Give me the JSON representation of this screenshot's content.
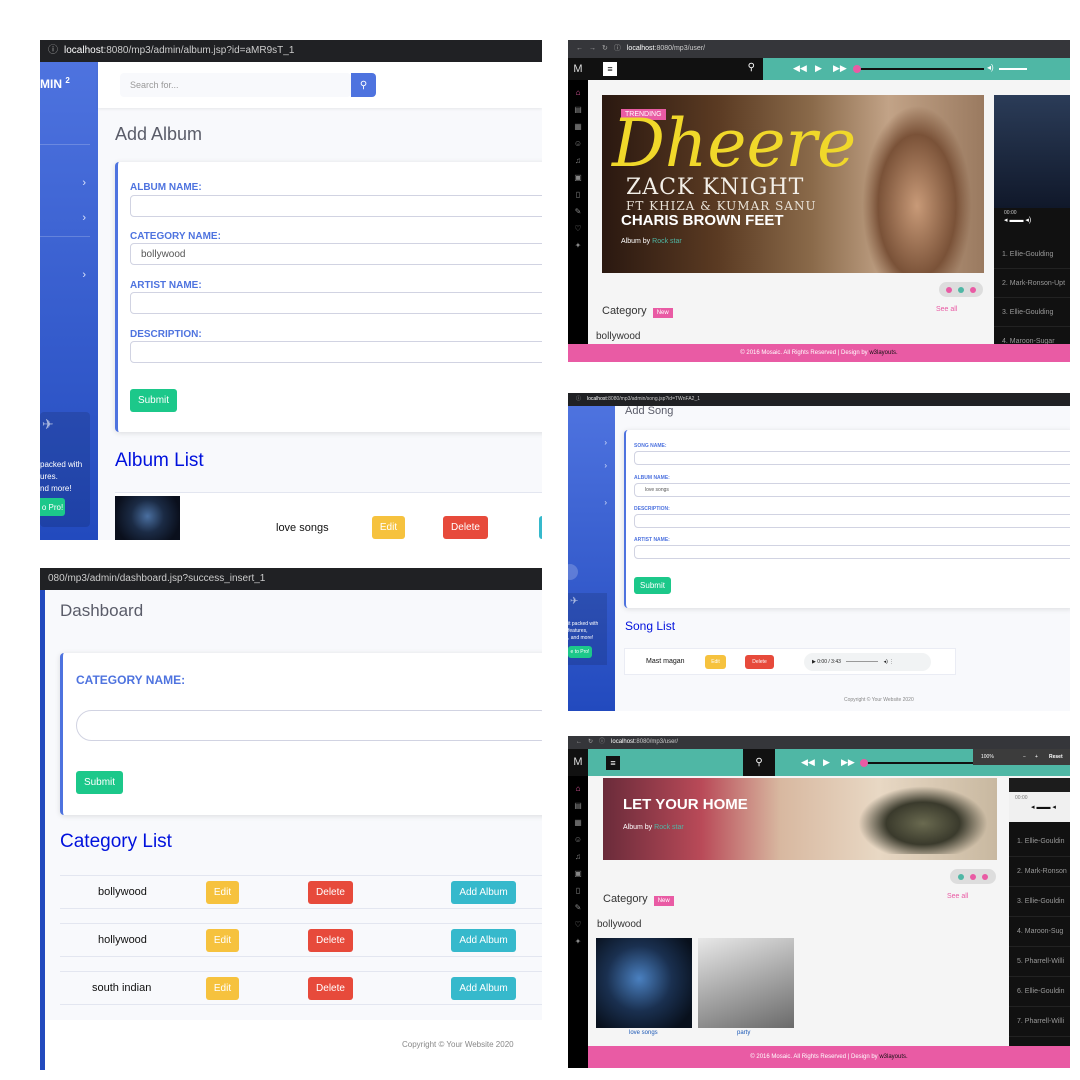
{
  "album_page": {
    "url_host": "localhost",
    "url_rest": ":8080/mp3/admin/album.jsp?id=aMR9sT_1",
    "brand": "MIN",
    "brand_sup": "2",
    "search_placeholder": "Search for...",
    "heading": "Add Album",
    "labels": [
      "ALBUM NAME:",
      "CATEGORY NAME:",
      "ARTIST NAME:",
      "DESCRIPTION:"
    ],
    "values": [
      "",
      "bollywood",
      "",
      ""
    ],
    "submit": "Submit",
    "list_title": "Album List",
    "promo_lines": [
      "packed with",
      "ures.",
      "nd more!"
    ],
    "promo_button": "o Pro!",
    "row": {
      "name": "love songs",
      "edit": "Edit",
      "delete": "Delete"
    }
  },
  "user_page_1": {
    "url_host": "localhost",
    "url_rest": ":8080/mp3/user/",
    "logo": "M",
    "trending": "TRENDING",
    "banner_script": "Dheere",
    "banner_artist": "ZACK KNIGHT",
    "banner_ft": "FT KHIZA & KUMAR SANU",
    "banner_sub": "CHARIS BROWN FEET",
    "album_by": "Album by",
    "album_by_link": "Rock star",
    "time": "00:00",
    "category": "Category",
    "new_badge": "New",
    "see_all": "See all",
    "cat_item": "bollywood",
    "songs": [
      "1. Ellie-Goulding",
      "2. Mark-Ronson-Upt",
      "3. Ellie-Goulding",
      "4. Maroon-Sugar"
    ],
    "footer_text": "© 2016 Mosaic. All Rights Reserved | Design by ",
    "footer_link": "w3layouts."
  },
  "song_page": {
    "url_host": "localhost",
    "url_rest": ":8080/mp3/admin/song.jsp?id=TWnFA2_1",
    "heading": "Add Song",
    "labels": [
      "SONG NAME:",
      "ALBUM NAME:",
      "DESCRIPTION:",
      "ARTIST NAME:"
    ],
    "values": [
      "",
      "love songs",
      "",
      ""
    ],
    "submit": "Submit",
    "list_title": "Song List",
    "promo_lines": [
      "it packed with",
      "features,",
      ", and more!"
    ],
    "promo_button": "e to Pro!",
    "row": {
      "name": "Mast magan",
      "edit": "Edit",
      "delete": "Delete",
      "time": "0:00 / 3:43"
    },
    "copyright": "Copyright © Your Website 2020"
  },
  "dashboard_page": {
    "url_rest": "080/mp3/admin/dashboard.jsp?success_insert_1",
    "heading": "Dashboard",
    "label": "CATEGORY NAME:",
    "submit": "Submit",
    "list_title": "Category List",
    "rows": [
      {
        "name": "bollywood",
        "edit": "Edit",
        "delete": "Delete",
        "add": "Add Album"
      },
      {
        "name": "hollywood",
        "edit": "Edit",
        "delete": "Delete",
        "add": "Add Album"
      },
      {
        "name": "south indian",
        "edit": "Edit",
        "delete": "Delete",
        "add": "Add Album"
      }
    ],
    "copyright": "Copyright © Your Website 2020"
  },
  "user_page_2": {
    "url_host": "localhost",
    "url_rest": ":8080/mp3/user/",
    "logo": "M",
    "zoom": "100%",
    "reset": "Reset",
    "banner_title": "LET YOUR HOME",
    "album_by": "Album by",
    "album_by_link": "Rock star",
    "time": "00:00",
    "category": "Category",
    "new_badge": "New",
    "see_all": "See all",
    "cat_item": "bollywood",
    "albums": [
      "love songs",
      "party"
    ],
    "songs": [
      "1. Ellie-Gouldin",
      "2. Mark-Ronson",
      "3. Ellie-Gouldin",
      "4. Maroon-Sug",
      "5. Pharrell-Willi",
      "6. Ellie-Gouldin",
      "7. Pharrell-Willi"
    ],
    "footer_text": "© 2016 Mosaic. All Rights Reserved | Design by ",
    "footer_link": "w3layouts."
  },
  "colors": {
    "admin_blue": "#4e73df",
    "success": "#1cc88a",
    "warning": "#f6c23e",
    "danger": "#e74a3b",
    "info": "#36b9cc",
    "mosaic_teal": "#4fb7a5",
    "mosaic_pink": "#e95ba4"
  }
}
